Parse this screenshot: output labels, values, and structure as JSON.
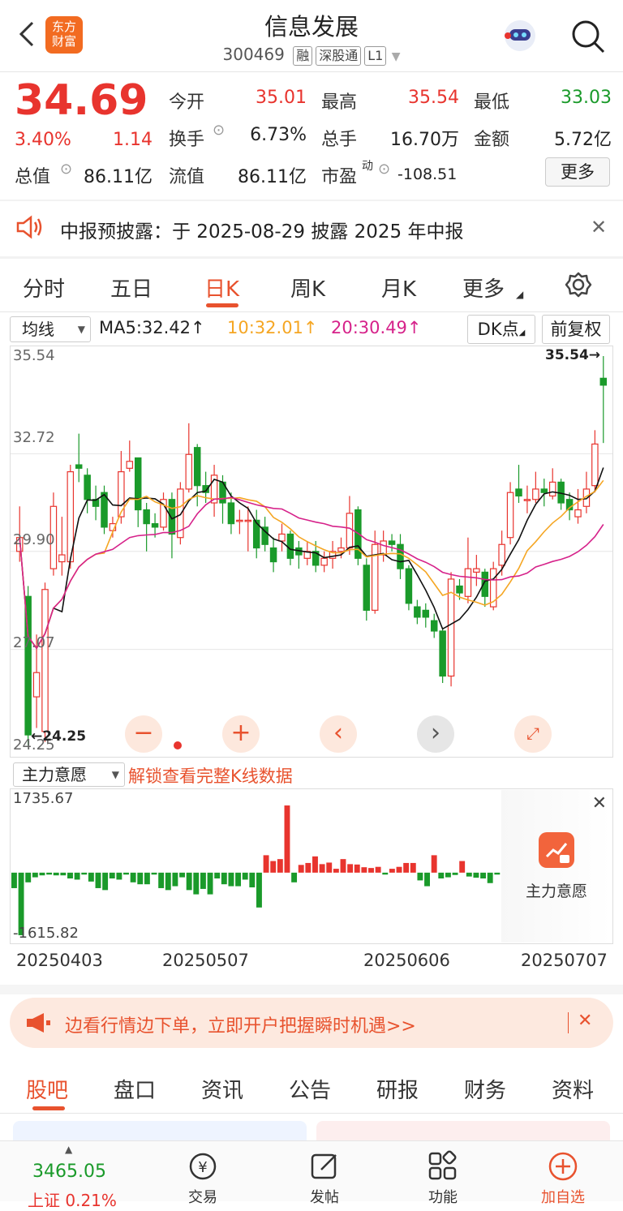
{
  "header": {
    "title": "信息发展",
    "code": "300469",
    "tags": [
      "融",
      "深股通",
      "L1"
    ],
    "logo_text": "东方\n财富"
  },
  "quote": {
    "price": "34.69",
    "change_pct": "3.40%",
    "change": "1.14",
    "open_label": "今开",
    "open": "35.01",
    "high_label": "最高",
    "high": "35.54",
    "low_label": "最低",
    "low": "33.03",
    "turnover_label": "换手",
    "turnover": "6.73%",
    "volume_label": "总手",
    "volume": "16.70万",
    "amount_label": "金额",
    "amount": "5.72亿",
    "mktcap_label": "总值",
    "mktcap": "86.11亿",
    "float_label": "流值",
    "float": "86.11亿",
    "pe_label": "市盈",
    "pe_sup": "动",
    "pe": "-108.51",
    "more": "更多"
  },
  "notice": {
    "text": "中报预披露：于 2025-08-29 披露 2025 年中报"
  },
  "chart_tabs": [
    "分时",
    "五日",
    "日K",
    "周K",
    "月K",
    "更多"
  ],
  "active_tab": "日K",
  "ma_bar": {
    "select": "均线",
    "ma5": "MA5:32.42",
    "ma10": "10:32.01",
    "ma20": "20:30.49",
    "dk": "DK点",
    "fq": "前复权"
  },
  "colors": {
    "up": "#e8342e",
    "down": "#1a9a2a",
    "ma5": "#111111",
    "ma10": "#f5a623",
    "ma20": "#d6228a",
    "accent": "#e8522e"
  },
  "kline_axis": {
    "max": "35.54",
    "l2": "32.72",
    "l3": "29.90",
    "l4": "27.07",
    "min": "24.25",
    "max_marker": "35.54→",
    "min_marker": "←24.25"
  },
  "flow": {
    "select": "主力意愿",
    "unlock": "解锁查看完整K线数据",
    "max": "1735.67",
    "min": "-1615.82",
    "lock_label": "主力意愿"
  },
  "dates": [
    "20250403",
    "20250507",
    "20250606",
    "20250707"
  ],
  "banner": {
    "text": "边看行情边下单，立即开户把握瞬时机遇>>"
  },
  "bottom_tabs": [
    "股吧",
    "盘口",
    "资讯",
    "公告",
    "研报",
    "财务",
    "资料"
  ],
  "bottom_nav": {
    "index_value": "3465.05",
    "index_label": "上证 0.21%",
    "items": [
      "交易",
      "发帖",
      "功能",
      "加自选"
    ]
  },
  "chart_data": {
    "type": "candlestick",
    "ylim": [
      24.25,
      35.54
    ],
    "candles": [
      {
        "o": 29.9,
        "c": 30.3,
        "h": 31.2,
        "l": 29.6
      },
      {
        "o": 28.6,
        "c": 24.6,
        "h": 28.9,
        "l": 24.3
      },
      {
        "o": 25.7,
        "c": 26.4,
        "h": 27.5,
        "l": 24.8
      },
      {
        "o": 24.7,
        "c": 28.8,
        "h": 29.0,
        "l": 24.4
      },
      {
        "o": 29.4,
        "c": 31.2,
        "h": 31.6,
        "l": 29.2
      },
      {
        "o": 29.6,
        "c": 29.8,
        "h": 30.9,
        "l": 29.2
      },
      {
        "o": 29.6,
        "c": 32.2,
        "h": 32.4,
        "l": 29.4
      },
      {
        "o": 32.4,
        "c": 32.3,
        "h": 33.3,
        "l": 31.9
      },
      {
        "o": 32.1,
        "c": 31.4,
        "h": 32.3,
        "l": 31.0
      },
      {
        "o": 31.4,
        "c": 31.2,
        "h": 31.8,
        "l": 30.8
      },
      {
        "o": 31.6,
        "c": 30.6,
        "h": 31.8,
        "l": 30.4
      },
      {
        "o": 30.5,
        "c": 30.7,
        "h": 30.9,
        "l": 30.3
      },
      {
        "o": 30.9,
        "c": 32.2,
        "h": 32.8,
        "l": 30.7
      },
      {
        "o": 32.3,
        "c": 32.5,
        "h": 33.1,
        "l": 32.2
      },
      {
        "o": 32.6,
        "c": 31.1,
        "h": 32.6,
        "l": 30.6
      },
      {
        "o": 31.1,
        "c": 30.7,
        "h": 31.3,
        "l": 29.9
      },
      {
        "o": 30.7,
        "c": 30.6,
        "h": 31.0,
        "l": 30.3
      },
      {
        "o": 30.6,
        "c": 31.4,
        "h": 31.6,
        "l": 30.5
      },
      {
        "o": 31.4,
        "c": 30.4,
        "h": 31.6,
        "l": 29.7
      },
      {
        "o": 30.3,
        "c": 31.7,
        "h": 31.9,
        "l": 30.1
      },
      {
        "o": 31.7,
        "c": 32.7,
        "h": 33.6,
        "l": 31.6
      },
      {
        "o": 32.9,
        "c": 31.8,
        "h": 33.0,
        "l": 31.2
      },
      {
        "o": 31.8,
        "c": 31.6,
        "h": 32.2,
        "l": 31.3
      },
      {
        "o": 31.3,
        "c": 32.1,
        "h": 32.4,
        "l": 30.9
      },
      {
        "o": 31.9,
        "c": 31.3,
        "h": 32.1,
        "l": 30.7
      },
      {
        "o": 31.3,
        "c": 30.7,
        "h": 31.6,
        "l": 30.4
      },
      {
        "o": 30.8,
        "c": 30.8,
        "h": 31.1,
        "l": 30.4
      },
      {
        "o": 30.8,
        "c": 30.8,
        "h": 31.2,
        "l": 29.9
      },
      {
        "o": 30.8,
        "c": 30.0,
        "h": 31.1,
        "l": 29.7
      },
      {
        "o": 30.6,
        "c": 30.1,
        "h": 30.9,
        "l": 29.9
      },
      {
        "o": 30.0,
        "c": 29.6,
        "h": 30.3,
        "l": 29.3
      },
      {
        "o": 30.2,
        "c": 30.4,
        "h": 30.7,
        "l": 29.9
      },
      {
        "o": 30.4,
        "c": 29.7,
        "h": 30.5,
        "l": 29.5
      },
      {
        "o": 30.0,
        "c": 29.8,
        "h": 30.2,
        "l": 29.4
      },
      {
        "o": 29.7,
        "c": 29.9,
        "h": 30.2,
        "l": 29.5
      },
      {
        "o": 29.9,
        "c": 29.5,
        "h": 30.2,
        "l": 29.3
      },
      {
        "o": 29.5,
        "c": 29.7,
        "h": 29.9,
        "l": 29.3
      },
      {
        "o": 29.7,
        "c": 29.9,
        "h": 30.2,
        "l": 29.4
      },
      {
        "o": 29.9,
        "c": 30.0,
        "h": 30.3,
        "l": 29.7
      },
      {
        "o": 30.0,
        "c": 31.0,
        "h": 31.5,
        "l": 29.8
      },
      {
        "o": 31.1,
        "c": 29.7,
        "h": 31.2,
        "l": 29.5
      },
      {
        "o": 29.5,
        "c": 28.2,
        "h": 29.7,
        "l": 27.9
      },
      {
        "o": 28.2,
        "c": 30.1,
        "h": 30.5,
        "l": 28.1
      },
      {
        "o": 29.8,
        "c": 30.2,
        "h": 30.5,
        "l": 29.6
      },
      {
        "o": 30.2,
        "c": 30.1,
        "h": 30.4,
        "l": 29.9
      },
      {
        "o": 30.1,
        "c": 29.4,
        "h": 30.4,
        "l": 29.1
      },
      {
        "o": 29.4,
        "c": 28.4,
        "h": 29.5,
        "l": 28.2
      },
      {
        "o": 28.3,
        "c": 28.0,
        "h": 28.5,
        "l": 27.8
      },
      {
        "o": 28.2,
        "c": 28.0,
        "h": 28.4,
        "l": 27.7
      },
      {
        "o": 27.9,
        "c": 27.6,
        "h": 28.1,
        "l": 27.4
      },
      {
        "o": 27.6,
        "c": 26.3,
        "h": 27.7,
        "l": 26.1
      },
      {
        "o": 26.3,
        "c": 29.1,
        "h": 29.3,
        "l": 26.0
      },
      {
        "o": 28.9,
        "c": 28.7,
        "h": 29.1,
        "l": 28.5
      },
      {
        "o": 28.6,
        "c": 29.4,
        "h": 30.3,
        "l": 28.4
      },
      {
        "o": 29.3,
        "c": 29.4,
        "h": 29.8,
        "l": 28.9
      },
      {
        "o": 29.3,
        "c": 28.6,
        "h": 29.4,
        "l": 28.3
      },
      {
        "o": 28.3,
        "c": 29.4,
        "h": 29.6,
        "l": 28.2
      },
      {
        "o": 29.5,
        "c": 30.1,
        "h": 30.5,
        "l": 29.2
      },
      {
        "o": 30.3,
        "c": 31.6,
        "h": 31.9,
        "l": 30.1
      },
      {
        "o": 31.7,
        "c": 31.5,
        "h": 32.4,
        "l": 31.3
      },
      {
        "o": 31.4,
        "c": 31.4,
        "h": 31.8,
        "l": 31.0
      },
      {
        "o": 31.4,
        "c": 31.7,
        "h": 32.2,
        "l": 31.3
      },
      {
        "o": 31.7,
        "c": 31.6,
        "h": 32.0,
        "l": 31.2
      },
      {
        "o": 31.5,
        "c": 31.9,
        "h": 32.3,
        "l": 31.4
      },
      {
        "o": 31.9,
        "c": 31.3,
        "h": 32.0,
        "l": 31.1
      },
      {
        "o": 31.4,
        "c": 31.1,
        "h": 31.6,
        "l": 30.8
      },
      {
        "o": 30.9,
        "c": 31.1,
        "h": 31.7,
        "l": 30.7
      },
      {
        "o": 31.2,
        "c": 31.7,
        "h": 32.2,
        "l": 31.0
      },
      {
        "o": 31.8,
        "c": 33.0,
        "h": 33.4,
        "l": 31.6
      },
      {
        "o": 34.9,
        "c": 34.7,
        "h": 35.54,
        "l": 33.03
      }
    ],
    "flow": [
      -400,
      -1615,
      -250,
      -120,
      -70,
      -50,
      -70,
      -70,
      -150,
      -180,
      -50,
      -230,
      -400,
      -450,
      -150,
      -180,
      -50,
      -250,
      -300,
      -300,
      -50,
      -400,
      -450,
      -350,
      -120,
      -450,
      -560,
      -420,
      -560,
      -150,
      -300,
      -350,
      -350,
      -180,
      -380,
      -900,
      450,
      300,
      350,
      1735,
      -250,
      200,
      250,
      420,
      220,
      260,
      100,
      350,
      220,
      210,
      140,
      120,
      150,
      -50,
      100,
      150,
      250,
      250,
      -200,
      -350,
      450,
      -150,
      -120,
      -60,
      300,
      -100,
      -130,
      -150,
      -270,
      -50
    ]
  }
}
